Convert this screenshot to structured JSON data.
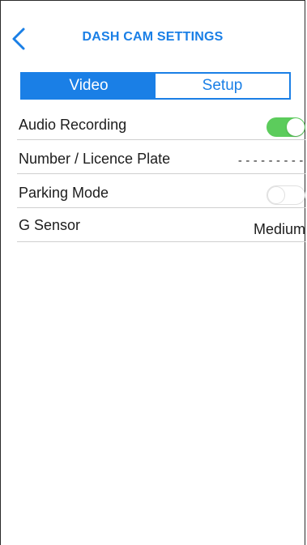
{
  "header": {
    "back_icon": "chevron-left-icon",
    "title": "DASH CAM SETTINGS"
  },
  "tabs": [
    {
      "label": "Video",
      "active": true
    },
    {
      "label": "Setup",
      "active": false
    }
  ],
  "settings": {
    "audio_recording": {
      "label": "Audio Recording",
      "enabled": true
    },
    "licence_plate": {
      "label": "Number / Licence Plate",
      "value": "---------"
    },
    "parking_mode": {
      "label": "Parking Mode",
      "enabled": false
    },
    "g_sensor": {
      "label": "G Sensor",
      "value": "Medium"
    }
  },
  "colors": {
    "accent": "#1a7fe6",
    "toggle_on": "#5ccc5c"
  }
}
